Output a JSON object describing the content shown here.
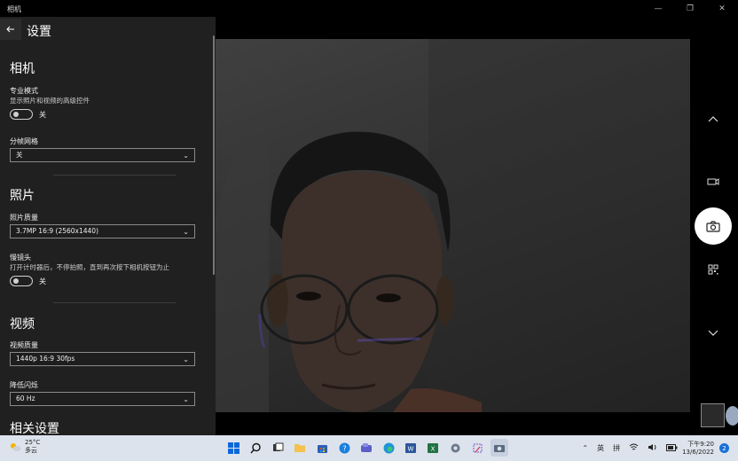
{
  "window": {
    "title": "相机"
  },
  "settings": {
    "title": "设置",
    "camera_heading": "相机",
    "pro_mode": {
      "label": "专业模式",
      "desc": "显示照片和视频的高级控件",
      "state": "关"
    },
    "framing_grid": {
      "label": "分帧网格",
      "value": "关"
    },
    "photo_heading": "照片",
    "photo_quality": {
      "label": "照片质量",
      "value": "3.7MP 16:9 (2560x1440)"
    },
    "timelapse": {
      "label": "慢镜头",
      "desc": "打开计时器后，不停拍照，直到再次按下相机按钮为止",
      "state": "关"
    },
    "video_heading": "视频",
    "video_quality": {
      "label": "视频质量",
      "value": "1440p 16:9 30fps"
    },
    "flicker": {
      "label": "降低闪烁",
      "value": "60 Hz"
    },
    "related_heading": "相关设置"
  },
  "taskbar": {
    "weather_temp": "25°C",
    "weather_desc": "多云",
    "ime_lang": "英",
    "ime_mode": "拼",
    "time": "下午9:20",
    "date": "13/6/2022",
    "notification_count": "2"
  },
  "colors": {
    "taskbar_bg": "#dde3ec",
    "settings_bg": "#202020",
    "accent": "#1a6fd6"
  }
}
